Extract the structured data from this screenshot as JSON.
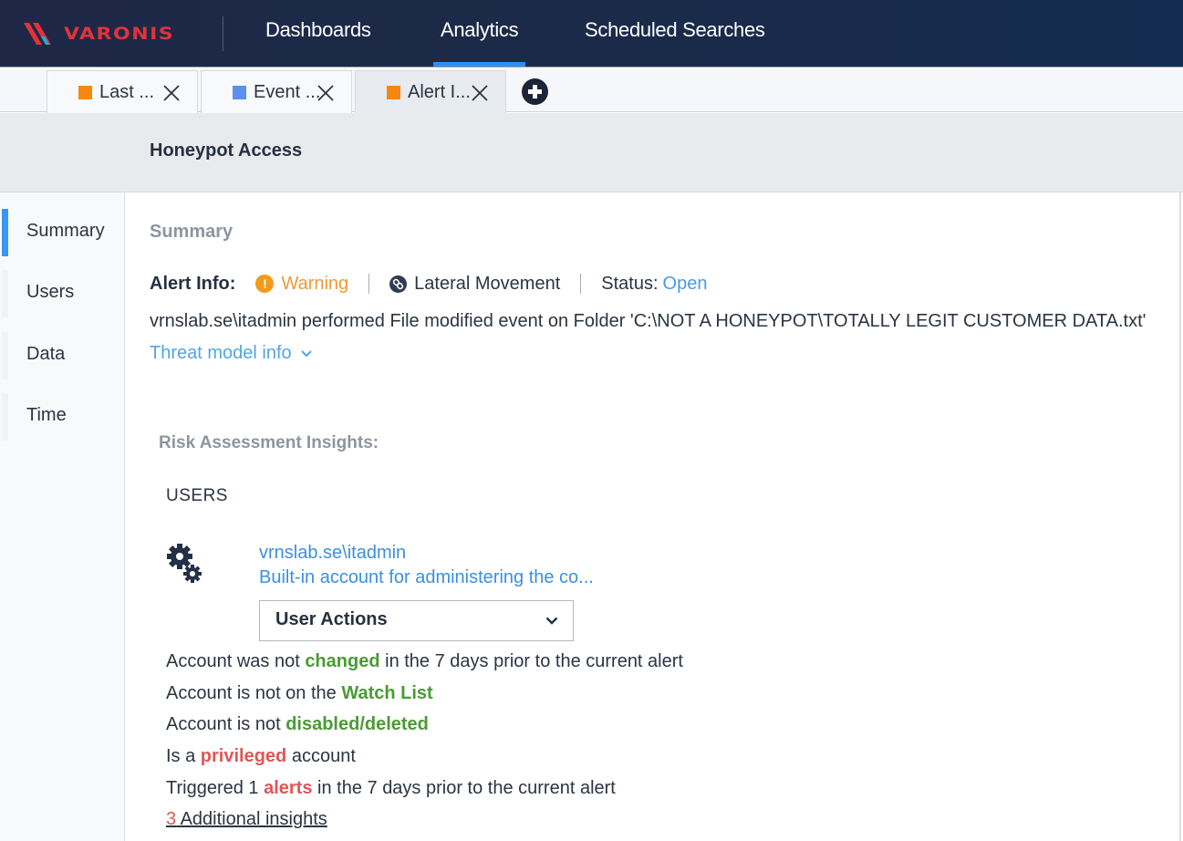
{
  "app": {
    "brand": "VARONIS",
    "nav": [
      {
        "label": "Dashboards",
        "active": false
      },
      {
        "label": "Analytics",
        "active": true
      },
      {
        "label": "Scheduled Searches",
        "active": false
      }
    ]
  },
  "tabs": [
    {
      "label": "Last ...",
      "color": "#f7880f",
      "active": false
    },
    {
      "label": "Event ...",
      "color": "#5b8ff0",
      "active": false
    },
    {
      "label": "Alert I...",
      "color": "#f7880f",
      "active": true
    }
  ],
  "alert": {
    "title": "Honeypot Access"
  },
  "sidenav": {
    "items": [
      {
        "label": "Summary",
        "active": true
      },
      {
        "label": "Users",
        "active": false
      },
      {
        "label": "Data",
        "active": false
      },
      {
        "label": "Time",
        "active": false
      }
    ]
  },
  "summary": {
    "section_title": "Summary",
    "alert_info_label": "Alert Info:",
    "severity": "Warning",
    "severity_icon": "exclamation-circle-icon",
    "category": "Lateral Movement",
    "category_icon": "link-icon",
    "status_label": "Status:",
    "status_value": "Open",
    "description": "vrnslab.se\\itadmin performed File modified event on Folder 'C:\\NOT A HONEYPOT\\TOTALLY LEGIT CUSTOMER DATA.txt'",
    "threat_model_link": "Threat model info",
    "colors": {
      "severity": "#f0993a",
      "link": "#4a9ae6",
      "positive": "#4a9a34",
      "negative": "#e05656"
    }
  },
  "risk": {
    "title": "Risk Assessment Insights:",
    "users_label": "USERS",
    "user": {
      "icon": "gears-icon",
      "name": "vrnslab.se\\itadmin",
      "description": "Built-in account for administering the co...",
      "actions_label": "User Actions"
    },
    "insights": [
      {
        "pre": "Account was not ",
        "hl": "changed",
        "post": " in the 7 days prior to the current alert",
        "tone": "green"
      },
      {
        "pre": "Account is not on the ",
        "hl": "Watch List",
        "post": "",
        "tone": "green"
      },
      {
        "pre": "Account is not ",
        "hl": "disabled/deleted",
        "post": "",
        "tone": "green"
      },
      {
        "pre": "Is a ",
        "hl": "privileged",
        "post": " account",
        "tone": "red"
      },
      {
        "pre": "Triggered 1 ",
        "hl": "alerts",
        "post": " in the 7 days prior to the current alert",
        "tone": "red"
      }
    ],
    "additional": {
      "count": "3",
      "label": " Additional insights"
    }
  }
}
